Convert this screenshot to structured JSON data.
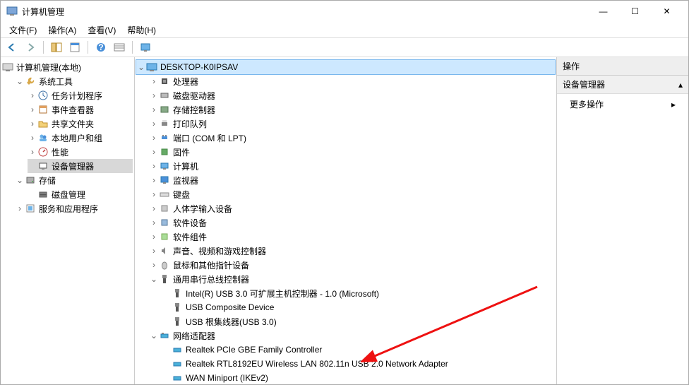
{
  "window": {
    "title": "计算机管理",
    "minimize": "—",
    "maximize": "☐",
    "close": "✕"
  },
  "menu": {
    "file": "文件(F)",
    "action": "操作(A)",
    "view": "查看(V)",
    "help": "帮助(H)"
  },
  "left_tree": {
    "root": "计算机管理(本地)",
    "system_tools": "系统工具",
    "task_scheduler": "任务计划程序",
    "event_viewer": "事件查看器",
    "shared_folders": "共享文件夹",
    "local_users": "本地用户和组",
    "performance": "性能",
    "device_manager": "设备管理器",
    "storage": "存储",
    "disk_mgmt": "磁盘管理",
    "services_apps": "服务和应用程序"
  },
  "mid_tree": {
    "computer": "DESKTOP-K0IPSAV",
    "processor": "处理器",
    "disk_drives": "磁盘驱动器",
    "storage_ctrl": "存储控制器",
    "print_queues": "打印队列",
    "ports": "端口 (COM 和 LPT)",
    "firmware": "固件",
    "computers": "计算机",
    "monitors": "监视器",
    "keyboards": "键盘",
    "hid": "人体学输入设备",
    "soft_devices": "软件设备",
    "soft_components": "软件组件",
    "sound": "声音、视频和游戏控制器",
    "mouse": "鼠标和其他指针设备",
    "usb_ctrl": "通用串行总线控制器",
    "usb1": "Intel(R) USB 3.0 可扩展主机控制器 - 1.0 (Microsoft)",
    "usb2": "USB Composite Device",
    "usb3": "USB 根集线器(USB 3.0)",
    "net_adapters": "网络适配器",
    "net1": "Realtek PCIe GBE Family Controller",
    "net2": "Realtek RTL8192EU Wireless LAN 802.11n USB 2.0 Network Adapter",
    "net3": "WAN Miniport (IKEv2)"
  },
  "right_pane": {
    "header": "操作",
    "section": "设备管理器",
    "more_actions": "更多操作"
  }
}
